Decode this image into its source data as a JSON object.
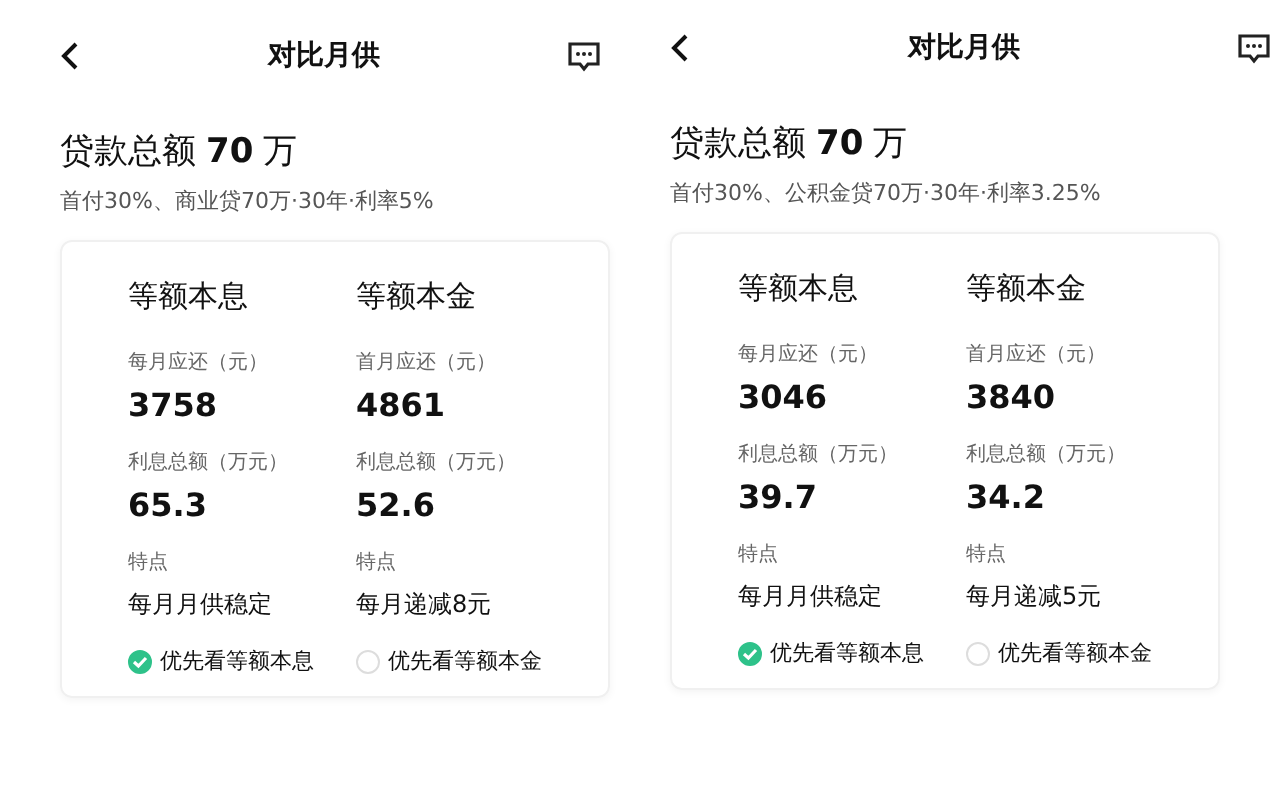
{
  "screens": [
    {
      "title": "对比月供",
      "total_label": "贷款总额",
      "total_amount": "70",
      "total_unit": "万",
      "subtitle": "首付30%、商业贷70万·30年·利率5%",
      "columns": [
        {
          "heading": "等额本息",
          "rows": [
            {
              "kind": "number",
              "label": "每月应还（元）",
              "value": "3758"
            },
            {
              "kind": "number",
              "label": "利息总额（万元）",
              "value": "65.3"
            },
            {
              "kind": "text",
              "label": "特点",
              "value": "每月月供稳定"
            }
          ],
          "option": {
            "label": "优先看等额本息",
            "selected": true
          }
        },
        {
          "heading": "等额本金",
          "rows": [
            {
              "kind": "number",
              "label": "首月应还（元）",
              "value": "4861"
            },
            {
              "kind": "number",
              "label": "利息总额（万元）",
              "value": "52.6"
            },
            {
              "kind": "text",
              "label": "特点",
              "value": "每月递减8元"
            }
          ],
          "option": {
            "label": "优先看等额本金",
            "selected": false
          }
        }
      ]
    },
    {
      "title": "对比月供",
      "total_label": "贷款总额",
      "total_amount": "70",
      "total_unit": "万",
      "subtitle": "首付30%、公积金贷70万·30年·利率3.25%",
      "columns": [
        {
          "heading": "等额本息",
          "rows": [
            {
              "kind": "number",
              "label": "每月应还（元）",
              "value": "3046"
            },
            {
              "kind": "number",
              "label": "利息总额（万元）",
              "value": "39.7"
            },
            {
              "kind": "text",
              "label": "特点",
              "value": "每月月供稳定"
            }
          ],
          "option": {
            "label": "优先看等额本息",
            "selected": true
          }
        },
        {
          "heading": "等额本金",
          "rows": [
            {
              "kind": "number",
              "label": "首月应还（元）",
              "value": "3840"
            },
            {
              "kind": "number",
              "label": "利息总额（万元）",
              "value": "34.2"
            },
            {
              "kind": "text",
              "label": "特点",
              "value": "每月递减5元"
            }
          ],
          "option": {
            "label": "优先看等额本金",
            "selected": false
          }
        }
      ]
    }
  ]
}
